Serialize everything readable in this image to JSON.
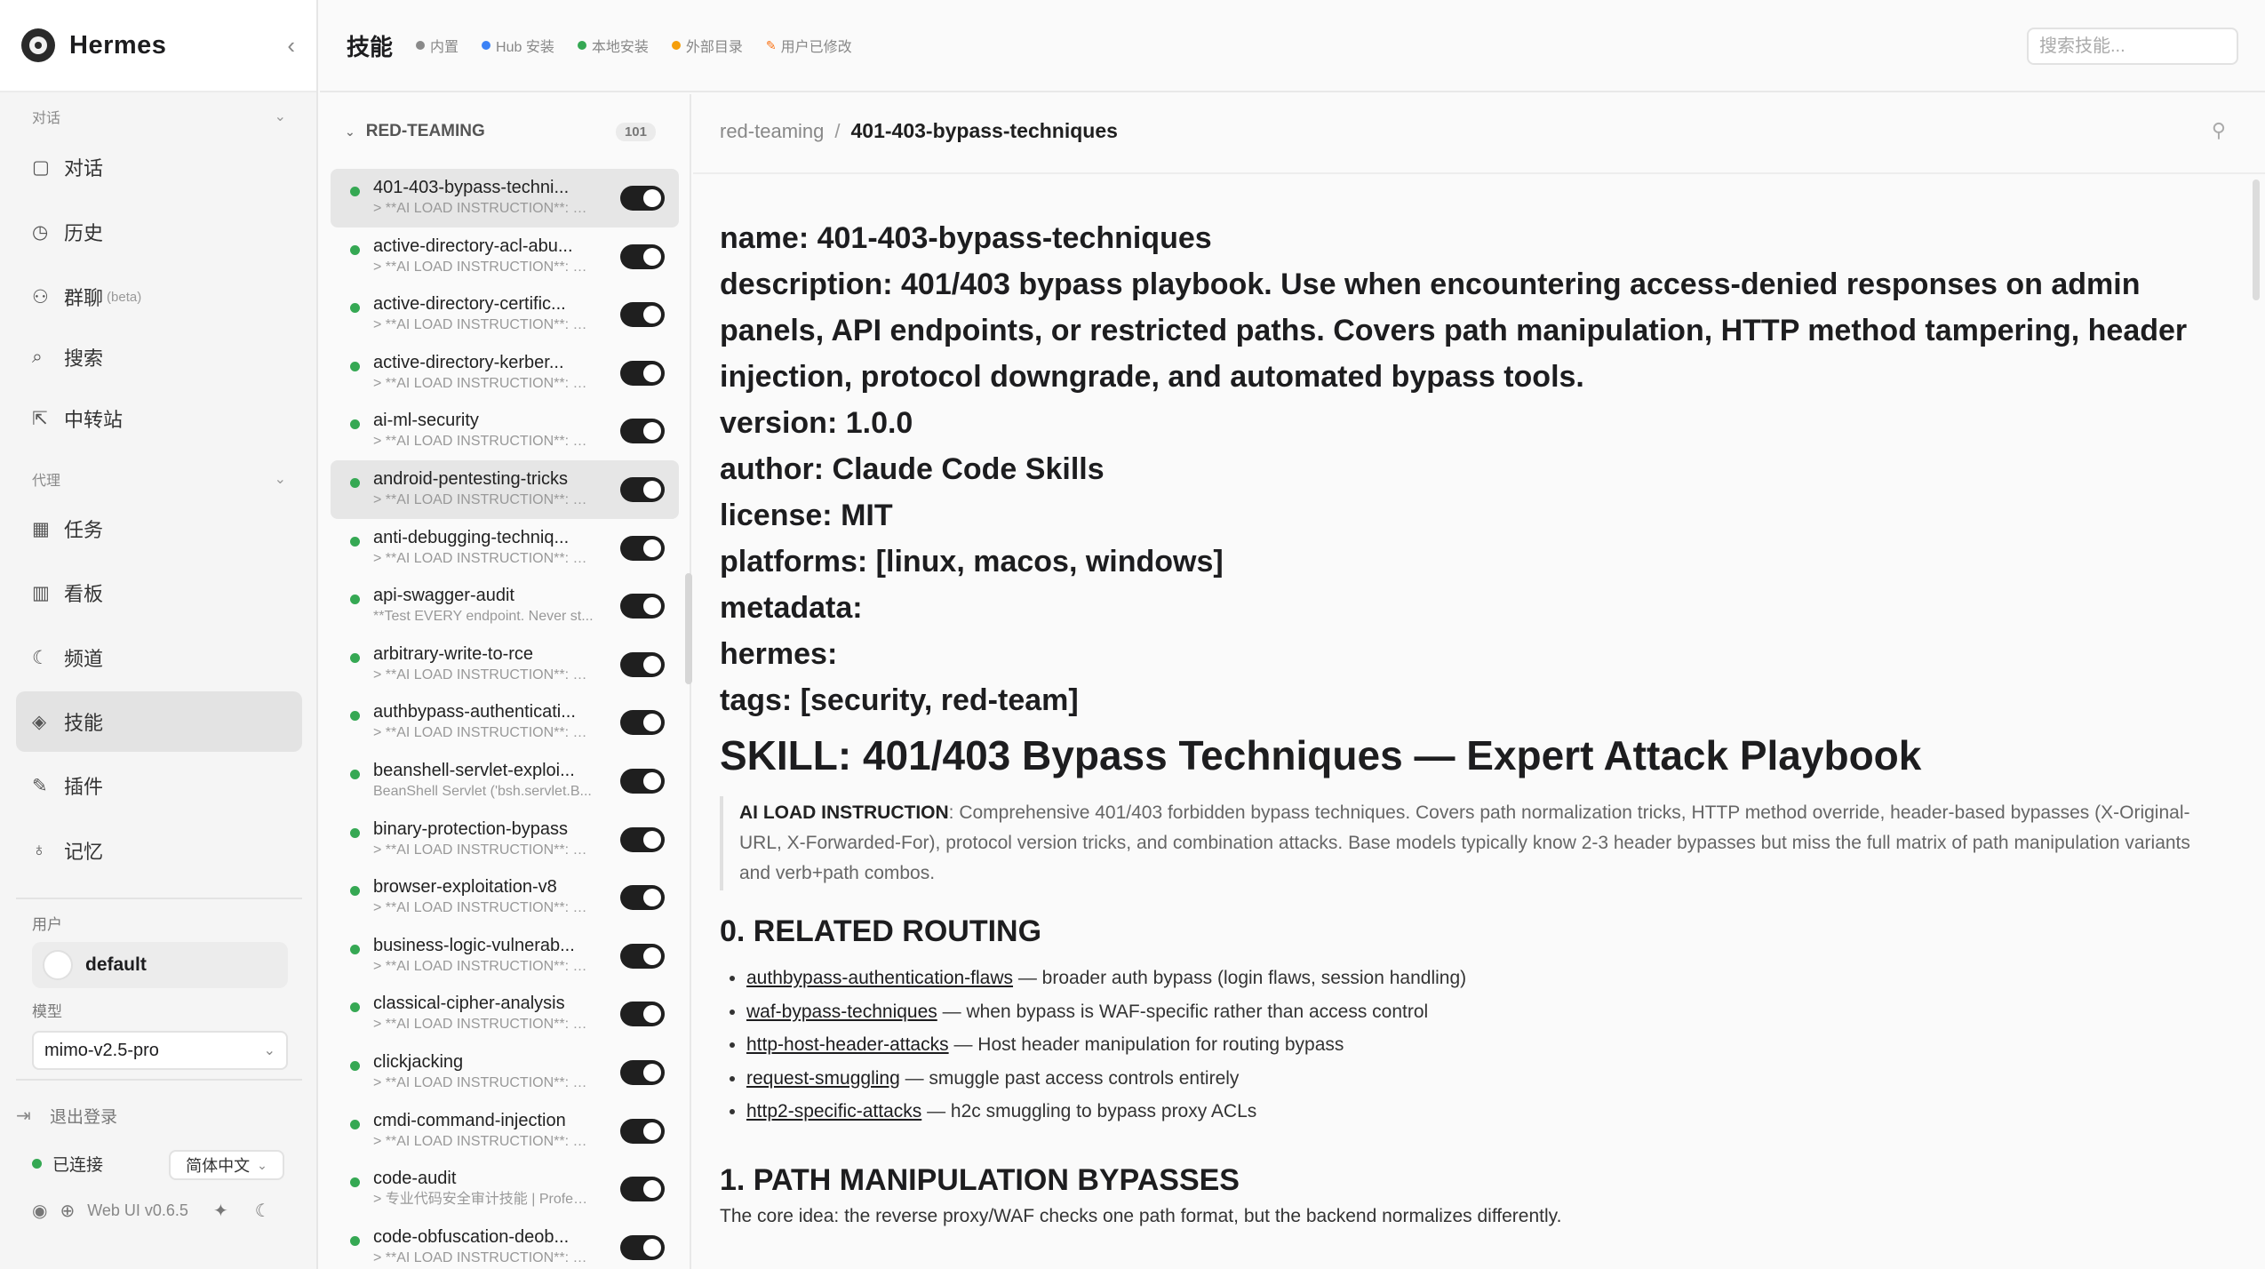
{
  "app": {
    "name": "Hermes"
  },
  "sidebar": {
    "section_chat": "对话",
    "section_agent": "代理",
    "items": [
      {
        "label": "对话",
        "icon": "chat-icon",
        "glyph": "▢"
      },
      {
        "label": "历史",
        "icon": "clock-icon",
        "glyph": "◷"
      },
      {
        "label": "群聊",
        "badge": "(beta)",
        "icon": "group-icon",
        "glyph": "⚇"
      },
      {
        "label": "搜索",
        "icon": "search-icon",
        "glyph": "⌕"
      },
      {
        "label": "中转站",
        "icon": "external-link-icon",
        "glyph": "⇱"
      },
      {
        "label": "任务",
        "icon": "calendar-icon",
        "glyph": "▦"
      },
      {
        "label": "看板",
        "icon": "board-icon",
        "glyph": "▥"
      },
      {
        "label": "频道",
        "icon": "moon-icon",
        "glyph": "☾"
      },
      {
        "label": "技能",
        "icon": "layers-icon",
        "glyph": "◈"
      },
      {
        "label": "插件",
        "icon": "wrench-icon",
        "glyph": "✎"
      },
      {
        "label": "记忆",
        "icon": "bulb-icon",
        "glyph": "♁"
      }
    ],
    "user_label": "用户",
    "user_name": "default",
    "model_label": "模型",
    "model_value": "mimo-v2.5-pro",
    "logout": "退出登录",
    "status": "已连接",
    "language": "简体中文",
    "version": "Web UI v0.6.5"
  },
  "topbar": {
    "title": "技能",
    "legend": [
      {
        "label": "内置",
        "color": "#8a8a8a"
      },
      {
        "label": "Hub 安装",
        "color": "#3b82f6"
      },
      {
        "label": "本地安装",
        "color": "#35a853"
      },
      {
        "label": "外部目录",
        "color": "#f59e0b"
      },
      {
        "label": "用户已修改",
        "color": "#f97316"
      }
    ],
    "search_placeholder": "搜索技能..."
  },
  "skill_list": {
    "category": "RED-TEAMING",
    "count": "101",
    "items": [
      {
        "name": "401-403-bypass-techni...",
        "desc": "> **AI LOAD INSTRUCTION**: C...",
        "selected": true
      },
      {
        "name": "active-directory-acl-abu...",
        "desc": "> **AI LOAD INSTRUCTION**: E..."
      },
      {
        "name": "active-directory-certific...",
        "desc": "> **AI LOAD INSTRUCTION**: E..."
      },
      {
        "name": "active-directory-kerber...",
        "desc": "> **AI LOAD INSTRUCTION**: E..."
      },
      {
        "name": "ai-ml-security",
        "desc": "> **AI LOAD INSTRUCTION**: E..."
      },
      {
        "name": "android-pentesting-tricks",
        "desc": "> **AI LOAD INSTRUCTION**: E...",
        "selected": true
      },
      {
        "name": "anti-debugging-techniq...",
        "desc": "> **AI LOAD INSTRUCTION**: E..."
      },
      {
        "name": "api-swagger-audit",
        "desc": "**Test EVERY endpoint. Never st..."
      },
      {
        "name": "arbitrary-write-to-rce",
        "desc": "> **AI LOAD INSTRUCTION**: E..."
      },
      {
        "name": "authbypass-authenticati...",
        "desc": "> **AI LOAD INSTRUCTION**: E..."
      },
      {
        "name": "beanshell-servlet-exploi...",
        "desc": "BeanShell Servlet ('bsh.servlet.B..."
      },
      {
        "name": "binary-protection-bypass",
        "desc": "> **AI LOAD INSTRUCTION**: E..."
      },
      {
        "name": "browser-exploitation-v8",
        "desc": "> **AI LOAD INSTRUCTION**: E..."
      },
      {
        "name": "business-logic-vulnerab...",
        "desc": "> **AI LOAD INSTRUCTION**: B..."
      },
      {
        "name": "classical-cipher-analysis",
        "desc": "> **AI LOAD INSTRUCTION**: E..."
      },
      {
        "name": "clickjacking",
        "desc": "> **AI LOAD INSTRUCTION**: Cl..."
      },
      {
        "name": "cmdi-command-injection",
        "desc": "> **AI LOAD INSTRUCTION**: E..."
      },
      {
        "name": "code-audit",
        "desc": "> 专业代码安全审计技能 | Profess..."
      },
      {
        "name": "code-obfuscation-deob...",
        "desc": "> **AI LOAD INSTRUCTION**: E..."
      }
    ]
  },
  "detail": {
    "breadcrumb_parent": "red-teaming",
    "breadcrumb_sep": "/",
    "breadcrumb_current": "401-403-bypass-techniques",
    "frontmatter": [
      "name: 401-403-bypass-techniques",
      "description: 401/403 bypass playbook. Use when encountering access-denied responses on admin panels, API endpoints, or restricted paths. Covers path manipulation, HTTP method tampering, header injection, protocol downgrade, and automated bypass tools.",
      "version: 1.0.0",
      "author: Claude Code Skills",
      "license: MIT",
      "platforms: [linux, macos, windows]",
      "metadata:",
      "hermes:",
      "tags: [security, red-team]"
    ],
    "h1": "SKILL: 401/403 Bypass Techniques — Expert Attack Playbook",
    "callout_label": "AI LOAD INSTRUCTION",
    "callout_text": ": Comprehensive 401/403 forbidden bypass techniques. Covers path normalization tricks, HTTP method override, header-based bypasses (X-Original-URL, X-Forwarded-For), protocol version tricks, and combination attacks. Base models typically know 2-3 header bypasses but miss the full matrix of path manipulation variants and verb+path combos.",
    "section0": "0. RELATED ROUTING",
    "routing": [
      {
        "link": "authbypass-authentication-flaws",
        "text": " — broader auth bypass (login flaws, session handling)"
      },
      {
        "link": "waf-bypass-techniques",
        "text": " — when bypass is WAF-specific rather than access control"
      },
      {
        "link": "http-host-header-attacks",
        "text": " — Host header manipulation for routing bypass"
      },
      {
        "link": "request-smuggling",
        "text": " — smuggle past access controls entirely"
      },
      {
        "link": "http2-specific-attacks",
        "text": " — h2c smuggling to bypass proxy ACLs"
      }
    ],
    "section1": "1. PATH MANIPULATION BYPASSES",
    "section1_text": "The core idea: the reverse proxy/WAF checks one path format, but the backend normalizes differently."
  }
}
